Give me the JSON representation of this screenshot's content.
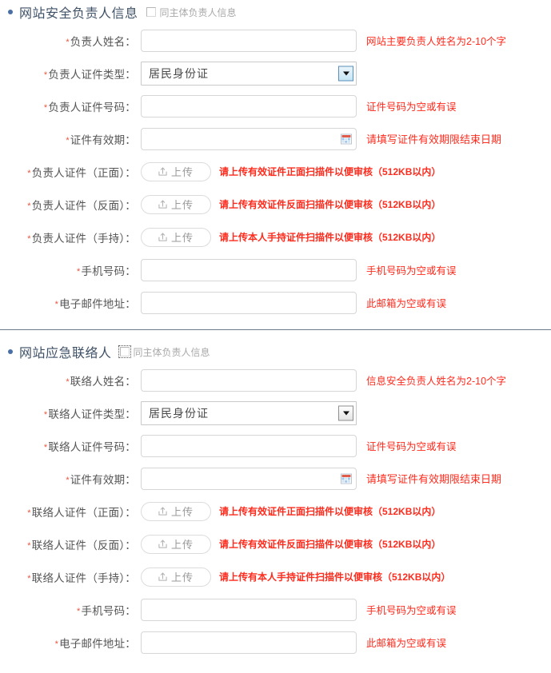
{
  "colors": {
    "bullet": "#4a6fa5",
    "section_title": "#3f5167",
    "required_asterisk": "#e8543f",
    "hint_red": "#ff2b1d",
    "divider": "#6b7c8d",
    "label": "#555555",
    "checkbox_label": "#a9a9a9"
  },
  "sections": [
    {
      "id": "website-security-officer",
      "title": "网站安全负责人信息",
      "same_as_entity_label": "同主体负责人信息",
      "same_as_entity_checked": false,
      "same_as_entity_focused": false,
      "rows": [
        {
          "id": "officer-name",
          "label": "负责人姓名：",
          "required": true,
          "control": "text",
          "value": "",
          "hint": "网站主要负责人姓名为2-10个字"
        },
        {
          "id": "officer-id-type",
          "label": "负责人证件类型：",
          "required": true,
          "control": "select",
          "value": "居民身份证",
          "arrow_style": "blue",
          "options": [
            "居民身份证"
          ],
          "hint": ""
        },
        {
          "id": "officer-id-number",
          "label": "负责人证件号码：",
          "required": true,
          "control": "text",
          "value": "",
          "hint": "证件号码为空或有误"
        },
        {
          "id": "officer-id-validity",
          "label": "证件有效期：",
          "required": true,
          "control": "date",
          "value": "",
          "hint": "请填写证件有效期限结束日期"
        },
        {
          "id": "officer-id-front",
          "label": "负责人证件（正面）：",
          "required": true,
          "control": "upload",
          "upload_label": "上传",
          "hint": "请上传有效证件正面扫描件以便审核（512KB以内）"
        },
        {
          "id": "officer-id-back",
          "label": "负责人证件（反面）：",
          "required": true,
          "control": "upload",
          "upload_label": "上传",
          "hint": "请上传有效证件反面扫描件以便审核（512KB以内）"
        },
        {
          "id": "officer-id-handheld",
          "label": "负责人证件（手持）：",
          "required": true,
          "control": "upload",
          "upload_label": "上传",
          "hint": "请上传本人手持证件扫描件以便审核（512KB以内）"
        },
        {
          "id": "officer-mobile",
          "label": "手机号码：",
          "required": true,
          "control": "text",
          "value": "",
          "hint": "手机号码为空或有误"
        },
        {
          "id": "officer-email",
          "label": "电子邮件地址：",
          "required": true,
          "control": "text",
          "value": "",
          "hint": "此邮箱为空或有误"
        }
      ]
    },
    {
      "id": "website-emergency-contact",
      "title": "网站应急联络人",
      "same_as_entity_label": "同主体负责人信息",
      "same_as_entity_checked": false,
      "same_as_entity_focused": true,
      "rows": [
        {
          "id": "contact-name",
          "label": "联络人姓名：",
          "required": true,
          "control": "text",
          "value": "",
          "hint": "信息安全负责人姓名为2-10个字"
        },
        {
          "id": "contact-id-type",
          "label": "联络人证件类型：",
          "required": true,
          "control": "select",
          "value": "居民身份证",
          "arrow_style": "gray",
          "options": [
            "居民身份证"
          ],
          "hint": ""
        },
        {
          "id": "contact-id-number",
          "label": "联络人证件号码：",
          "required": true,
          "control": "text",
          "value": "",
          "hint": "证件号码为空或有误"
        },
        {
          "id": "contact-id-validity",
          "label": "证件有效期：",
          "required": true,
          "control": "date",
          "value": "",
          "hint": "请填写证件有效期限结束日期"
        },
        {
          "id": "contact-id-front",
          "label": "联络人证件（正面）：",
          "required": true,
          "control": "upload",
          "upload_label": "上传",
          "hint": "请上传有效证件正面扫描件以便审核（512KB以内）"
        },
        {
          "id": "contact-id-back",
          "label": "联络人证件（反面）：",
          "required": true,
          "control": "upload",
          "upload_label": "上传",
          "hint": "请上传有效证件反面扫描件以便审核（512KB以内）"
        },
        {
          "id": "contact-id-handheld",
          "label": "联络人证件（手持）：",
          "required": true,
          "control": "upload",
          "upload_label": "上传",
          "hint": "请上传有本人手持证件扫描件以便审核（512KB以内）"
        },
        {
          "id": "contact-mobile",
          "label": "手机号码：",
          "required": true,
          "control": "text",
          "value": "",
          "hint": "手机号码为空或有误"
        },
        {
          "id": "contact-email",
          "label": "电子邮件地址：",
          "required": true,
          "control": "text",
          "value": "",
          "hint": "此邮箱为空或有误"
        }
      ]
    }
  ],
  "icons": {
    "upload": "upload-icon",
    "calendar": "calendar-icon",
    "caret": "chevron-down-icon"
  }
}
